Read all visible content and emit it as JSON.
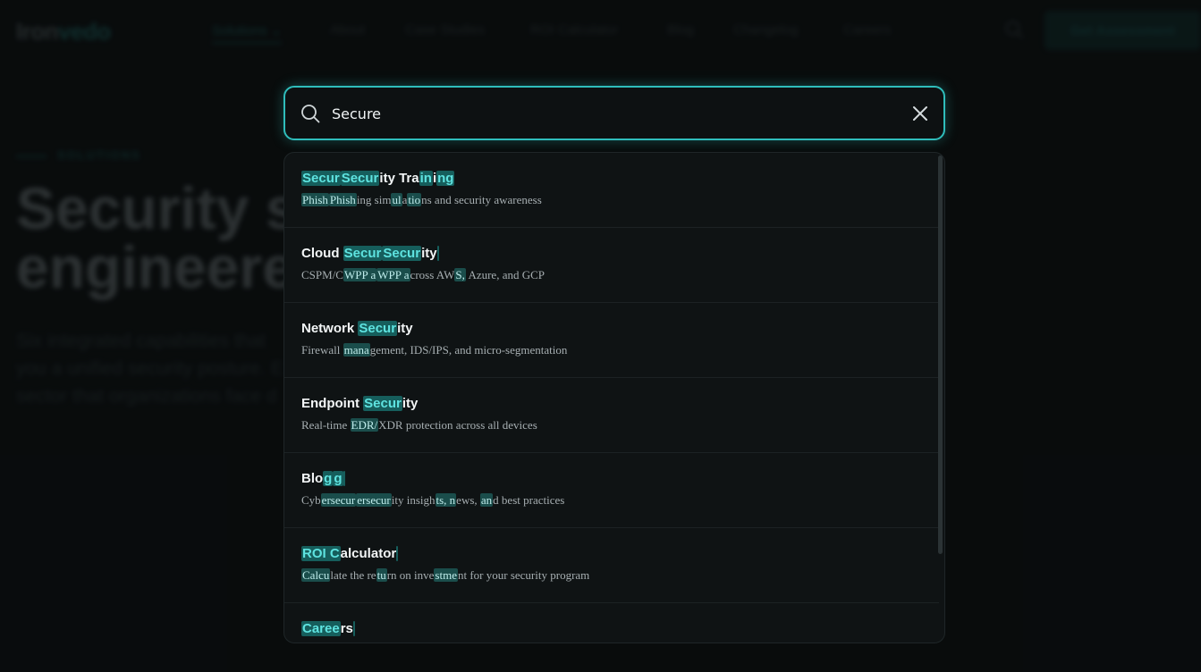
{
  "background": {
    "logo": {
      "part1": "Iron",
      "part2": "vedo"
    },
    "nav": [
      "Solutions",
      "About",
      "Case Studies",
      "ROI Calculator",
      "Blog",
      "Changelog",
      "Careers"
    ],
    "cta_label": "Get Assessment",
    "eyebrow": "SOLUTIONS",
    "hero_title": "Security s\nengineere",
    "hero_sub": "Six integrated capabilities that\nyou a unified security posture. E\nsector that organizations face d"
  },
  "search": {
    "value": "Secure",
    "icon": "search-icon",
    "clear_icon": "close-icon",
    "accent_color": "#2fbdbb"
  },
  "results": [
    {
      "title": [
        {
          "h": "Secur"
        },
        {
          "h": "Secur"
        },
        {
          "t": "ity Tra"
        },
        {
          "h": "in"
        },
        {
          "t": "i"
        },
        {
          "h": "ng"
        }
      ],
      "desc": [
        {
          "h": "Phish"
        },
        {
          "h": "Phish"
        },
        {
          "t": "ing sim"
        },
        {
          "h": "ul"
        },
        {
          "t": "a"
        },
        {
          "h": "tio"
        },
        {
          "t": "ns and security awareness"
        }
      ]
    },
    {
      "title": [
        {
          "t": "Cloud "
        },
        {
          "h": "Secur"
        },
        {
          "h": "Secur"
        },
        {
          "t": "ity"
        },
        {
          "h": " "
        }
      ],
      "desc": [
        {
          "t": "CSPM/C"
        },
        {
          "h": "WPP a"
        },
        {
          "h": "WPP a"
        },
        {
          "t": "cross AW"
        },
        {
          "h": "S,"
        },
        {
          "t": " Azure, and GCP"
        }
      ]
    },
    {
      "title": [
        {
          "t": "Network "
        },
        {
          "h": "Secur"
        },
        {
          "t": "ity"
        }
      ],
      "desc": [
        {
          "t": "Firewall "
        },
        {
          "h": "mana"
        },
        {
          "t": "gement, IDS/IPS, and micro-segmentation"
        }
      ]
    },
    {
      "title": [
        {
          "t": "Endpoint "
        },
        {
          "h": "Secur"
        },
        {
          "t": "ity"
        }
      ],
      "desc": [
        {
          "t": "Real-time "
        },
        {
          "h": "EDR/"
        },
        {
          "t": "XDR protection across all devices"
        }
      ]
    },
    {
      "title": [
        {
          "t": "Blo"
        },
        {
          "h": "g"
        },
        {
          "h": "g"
        },
        {
          "h": " "
        }
      ],
      "desc": [
        {
          "t": "Cyb"
        },
        {
          "h": "ersecur"
        },
        {
          "h": "ersecur"
        },
        {
          "t": "ity insigh"
        },
        {
          "h": "ts, n"
        },
        {
          "t": "ews, "
        },
        {
          "h": "an"
        },
        {
          "t": "d best practices"
        }
      ]
    },
    {
      "title": [
        {
          "h": "ROI C"
        },
        {
          "t": "alculator"
        },
        {
          "h": " "
        }
      ],
      "desc": [
        {
          "h": "Calcu"
        },
        {
          "t": "late the re"
        },
        {
          "h": "tu"
        },
        {
          "t": "rn on inve"
        },
        {
          "h": "stme"
        },
        {
          "t": "nt for your security program"
        }
      ]
    },
    {
      "title": [
        {
          "h": "Caree"
        },
        {
          "t": "rs"
        },
        {
          "h": " "
        }
      ],
      "desc": []
    }
  ]
}
